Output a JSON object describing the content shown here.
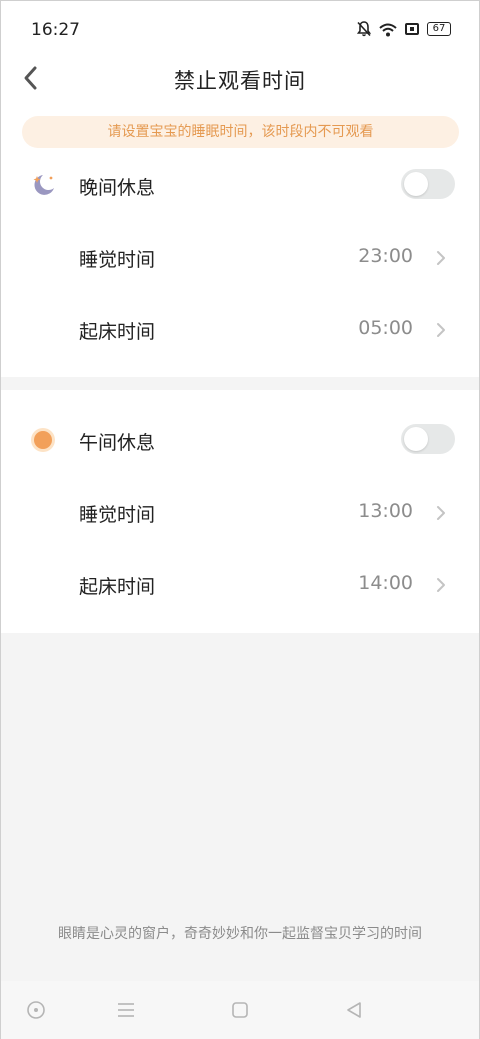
{
  "status_bar": {
    "time": "16:27",
    "battery": "67",
    "icons": [
      "mute-bell-icon",
      "wifi-icon",
      "sim-icon",
      "battery-icon"
    ]
  },
  "header": {
    "title": "禁止观看时间",
    "back_icon": "chevron-left-icon"
  },
  "notice": "请设置宝宝的睡眠时间，该时段内不可观看",
  "night": {
    "icon": "moon-icon",
    "label": "晚间休息",
    "enabled": false,
    "sleep_label": "睡觉时间",
    "sleep_time": "23:00",
    "wake_label": "起床时间",
    "wake_time": "05:00"
  },
  "noon": {
    "icon": "sun-icon",
    "label": "午间休息",
    "enabled": false,
    "sleep_label": "睡觉时间",
    "sleep_time": "13:00",
    "wake_label": "起床时间",
    "wake_time": "14:00"
  },
  "footer": "眼睛是心灵的窗户，奇奇妙妙和你一起监督宝贝学习的时间",
  "colors": {
    "accent": "#e59a52",
    "notice_bg": "#fdf0e3",
    "moon": "#9a97c0",
    "sun": "#f2a05a",
    "toggle_off": "#e6e8e8"
  },
  "nav": [
    "home-circle-icon",
    "menu-icon",
    "square-icon",
    "back-triangle-icon"
  ]
}
